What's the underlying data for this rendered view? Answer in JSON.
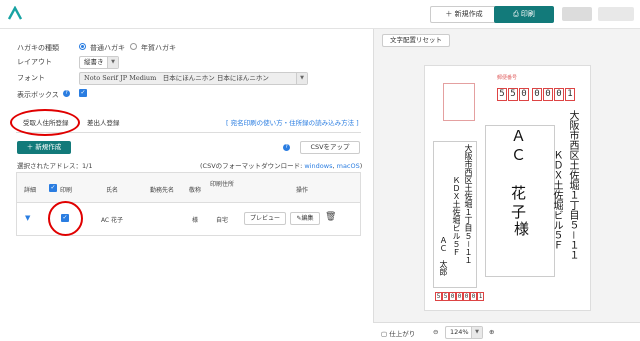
{
  "header": {
    "new_label": "＋ 新規作成",
    "print_label": "印刷"
  },
  "settings": {
    "card_type_label": "ハガキの種類",
    "card_type_options": [
      "普通ハガキ",
      "年賀ハガキ"
    ],
    "layout_label": "レイアウト",
    "layout_value": "縦書き",
    "font_label": "フォント",
    "font_value": "Noto Serif JP Medium　日本にほんニホン 日本にほんニホン",
    "display_box_label": "表示ボックス"
  },
  "tabs": {
    "recipient": "受取人住所登録",
    "sender": "差出人登録"
  },
  "help_link": "[ 宛名印刷の使い方・住所録の読み込み方法 ]",
  "actions": {
    "new": "新規作成",
    "csv": "CSVをアップ"
  },
  "selected_count": "選択されたアドレス：1/1",
  "csv_format": {
    "prefix": "(CSVのフォーマットダウンロード: ",
    "win": "windows",
    "sep": ", ",
    "mac": "macOS",
    "suffix": ")"
  },
  "table": {
    "headers": [
      "詳細",
      "印刷",
      "氏名",
      "勤務先名",
      "敬称",
      "印刷住所",
      "操作"
    ],
    "row": {
      "name": "AC 花子",
      "honorific": "様",
      "address_type": "自宅",
      "preview": "プレビュー",
      "edit": "編集"
    }
  },
  "preview": {
    "reset_label": "文字配置リセット",
    "zip": [
      "5",
      "5",
      "0",
      "0",
      "0",
      "0",
      "1"
    ],
    "recipient_addr1": "大阪市西区土佐堀１丁目５－１１",
    "recipient_addr2": "ＫＤＸ土佐堀ビル５Ｆ",
    "recipient_name": "ＡＣ　花子",
    "recipient_sama": "様",
    "sender_addr1": "大阪市西区土佐堀１丁目５－１１",
    "sender_addr2": "ＫＤＸ土佐堀ビル５Ｆ",
    "sender_name": "ＡＣ　太郎",
    "sender_zip": [
      "5",
      "5",
      "0",
      "0",
      "0",
      "0",
      "1"
    ],
    "finish_label": "仕上がり",
    "zoom": "124%"
  }
}
